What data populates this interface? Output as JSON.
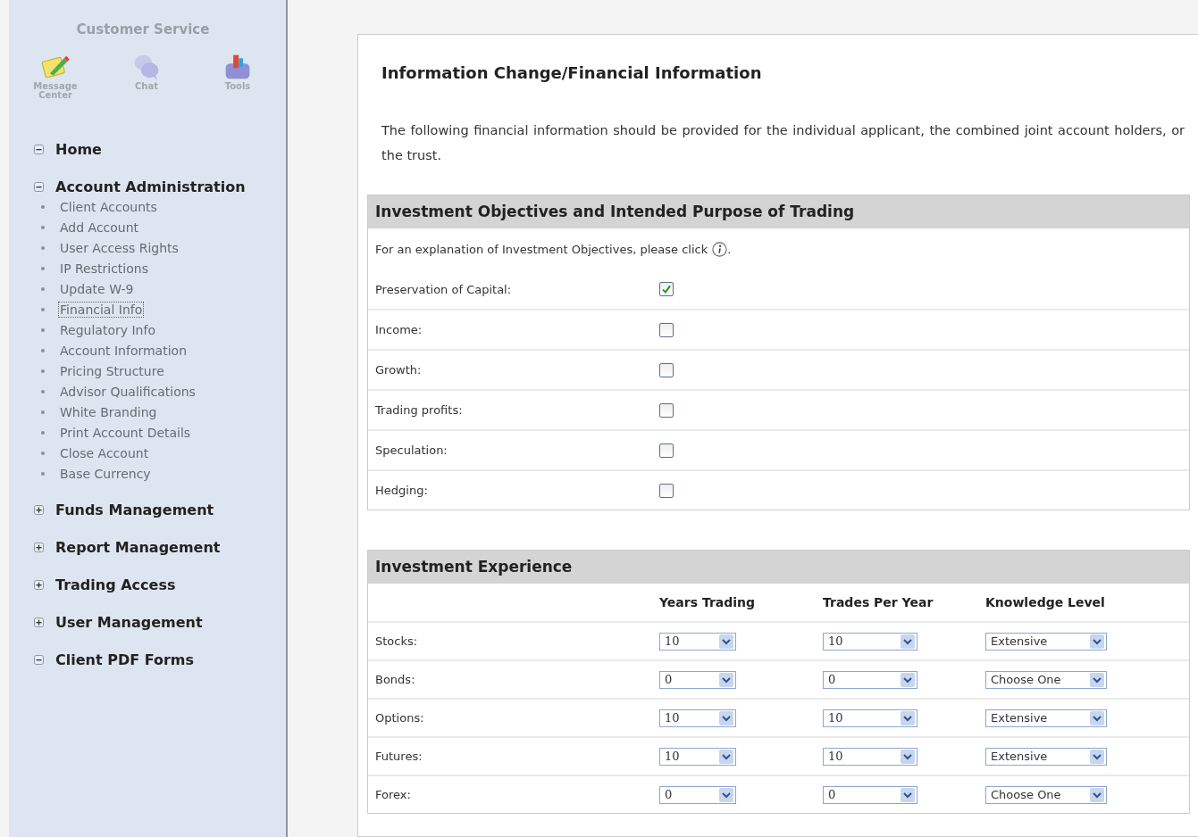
{
  "sidebar": {
    "title": "Customer Service",
    "tools": [
      {
        "label": "Message Center",
        "kind": "message"
      },
      {
        "label": "Chat",
        "kind": "chat"
      },
      {
        "label": "Tools",
        "kind": "tools"
      }
    ],
    "sections": [
      {
        "label": "Home",
        "expanded": true
      },
      {
        "label": "Account Administration",
        "expanded": true,
        "items": [
          {
            "label": "Client Accounts",
            "selected": false
          },
          {
            "label": "Add Account",
            "selected": false
          },
          {
            "label": "User Access Rights",
            "selected": false
          },
          {
            "label": "IP Restrictions",
            "selected": false
          },
          {
            "label": "Update W-9",
            "selected": false
          },
          {
            "label": "Financial Info",
            "selected": true
          },
          {
            "label": "Regulatory Info",
            "selected": false
          },
          {
            "label": "Account Information",
            "selected": false
          },
          {
            "label": "Pricing Structure",
            "selected": false
          },
          {
            "label": "Advisor Qualifications",
            "selected": false
          },
          {
            "label": "White Branding",
            "selected": false
          },
          {
            "label": "Print Account Details",
            "selected": false
          },
          {
            "label": "Close Account",
            "selected": false
          },
          {
            "label": "Base Currency",
            "selected": false
          }
        ]
      },
      {
        "label": "Funds Management",
        "expanded": false
      },
      {
        "label": "Report Management",
        "expanded": false
      },
      {
        "label": "Trading Access",
        "expanded": false
      },
      {
        "label": "User Management",
        "expanded": false
      },
      {
        "label": "Client PDF Forms",
        "expanded": true
      }
    ]
  },
  "page": {
    "title": "Information Change/Financial Information",
    "intro": "The following financial information should be provided for the individual applicant, the combined joint account holders, or the trust."
  },
  "objectives": {
    "title": "Investment Objectives and Intended Purpose of Trading",
    "explanation": "For an explanation of Investment Objectives, please click",
    "explanation_end": ".",
    "options": [
      {
        "label": "Preservation of Capital:",
        "checked": true
      },
      {
        "label": "Income:",
        "checked": false
      },
      {
        "label": "Growth:",
        "checked": false
      },
      {
        "label": "Trading profits:",
        "checked": false
      },
      {
        "label": "Speculation:",
        "checked": false
      },
      {
        "label": "Hedging:",
        "checked": false
      }
    ]
  },
  "experience": {
    "title": "Investment Experience",
    "columns": [
      "Years Trading",
      "Trades Per Year",
      "Knowledge Level"
    ],
    "rows": [
      {
        "asset": "Stocks:",
        "years": "10",
        "trades": "10",
        "knowledge": "Extensive"
      },
      {
        "asset": "Bonds:",
        "years": "0",
        "trades": "0",
        "knowledge": "Choose One"
      },
      {
        "asset": "Options:",
        "years": "10",
        "trades": "10",
        "knowledge": "Extensive"
      },
      {
        "asset": "Futures:",
        "years": "10",
        "trades": "10",
        "knowledge": "Extensive"
      },
      {
        "asset": "Forex:",
        "years": "0",
        "trades": "0",
        "knowledge": "Choose One"
      }
    ]
  }
}
